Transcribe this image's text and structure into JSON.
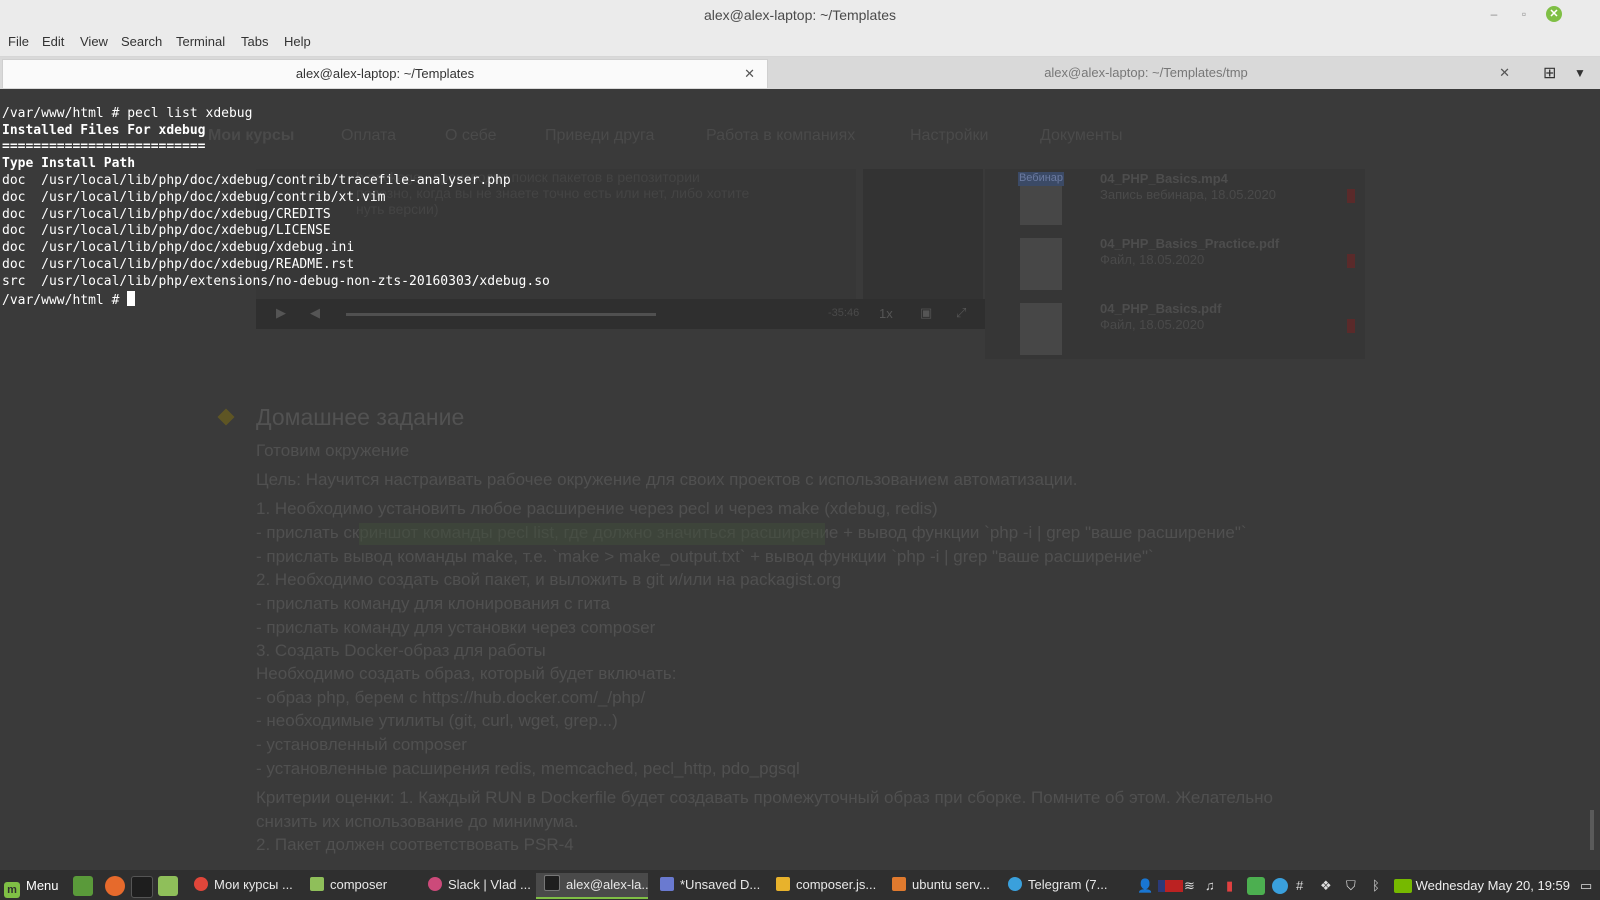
{
  "window": {
    "title": "alex@alex-laptop: ~/Templates",
    "buttons": [
      "–",
      "▫",
      "✕"
    ]
  },
  "menubar": [
    "File",
    "Edit",
    "View",
    "Search",
    "Terminal",
    "Tabs",
    "Help"
  ],
  "tabs": [
    {
      "label": "alex@alex-laptop: ~/Templates",
      "active": true
    },
    {
      "label": "alex@alex-laptop: ~/Templates/tmp",
      "active": false
    }
  ],
  "terminal": {
    "lines": [
      {
        "text": "/var/www/html # pecl list xdebug",
        "bold": false
      },
      {
        "text": "Installed Files For xdebug",
        "bold": true
      },
      {
        "text": "==========================",
        "bold": true
      },
      {
        "text": "Type Install Path",
        "bold": true
      },
      {
        "text": "doc  /usr/local/lib/php/doc/xdebug/contrib/tracefile-analyser.php",
        "bold": false
      },
      {
        "text": "doc  /usr/local/lib/php/doc/xdebug/contrib/xt.vim",
        "bold": false
      },
      {
        "text": "doc  /usr/local/lib/php/doc/xdebug/CREDITS",
        "bold": false
      },
      {
        "text": "doc  /usr/local/lib/php/doc/xdebug/LICENSE",
        "bold": false
      },
      {
        "text": "doc  /usr/local/lib/php/doc/xdebug/xdebug.ini",
        "bold": false
      },
      {
        "text": "doc  /usr/local/lib/php/doc/xdebug/README.rst",
        "bold": false
      },
      {
        "text": "src  /usr/local/lib/php/extensions/no-debug-non-zts-20160303/xdebug.so",
        "bold": false
      }
    ],
    "prompt": "/var/www/html # "
  },
  "background_page": {
    "nav": [
      "Мои курсы",
      "Оплата",
      "О себе",
      "Приведи друга",
      "Работа в компаниях",
      "Настройки",
      "Документы"
    ],
    "video_text": [
      "h package - производит поиск пакетов в репозитории",
      "полезно, когда вы не знаете точно есть или нет, либо хотите",
      "нуть версии)"
    ],
    "video_controls": {
      "speed": "1x",
      "time": "-35:46"
    },
    "files": [
      {
        "name": "04_PHP_Basics.mp4",
        "meta": "Запись вебинара, 18.05.2020",
        "chip": "Вебинар"
      },
      {
        "name": "04_PHP_Basics_Practice.pdf",
        "meta": "Файл, 18.05.2020"
      },
      {
        "name": "04_PHP_Basics.pdf",
        "meta": "Файл, 18.05.2020"
      }
    ],
    "homework": {
      "title": "Домашнее задание",
      "subtitle": "Готовим окружение",
      "goal": "Цель: Научится настраивать рабочее окружение для своих проектов с использованием автоматизации.",
      "lines": [
        "1. Необходимо установить любое расширение через pecl и через make (xdebug, redis)",
        "- прислать скриншот команды pecl list, где должно значиться расширение + вывод функции `php -i | grep \"ваше расширение\"`",
        "- прислать вывод команды make, т.е. `make > make_output.txt` + вывод функции `php -i | grep \"ваше расширение\"`",
        "2. Необходимо создать свой пакет, и выложить в git и/или на packagist.org",
        "- прислать команду для клонирования с гита",
        "- прислать команду для установки через composer",
        "3. Создать Docker-образ для работы",
        "Необходимо создать образ, который будет включать:",
        "- образ php, берем с https://hub.docker.com/_/php/",
        "- необходимые утилиты (git, curl, wget, grep...)",
        "- установленный composer",
        "- установленные расширения redis, memcached, pecl_http, pdo_pgsql"
      ],
      "criteria": [
        "Критерии оценки: 1. Каждый RUN в Dockerfile будет создавать промежуточный образ при сборке. Помните об этом. Желательно",
        "снизить их использование до минимума.",
        "2. Пакет должен соответствовать PSR-4"
      ]
    }
  },
  "taskbar": {
    "menu_label": "Menu",
    "tasks": [
      {
        "label": "Мои курсы ...",
        "color": "#e0463a"
      },
      {
        "label": "composer",
        "color": "#8fbf5a"
      },
      {
        "label": "Slack | Vlad ...",
        "color": "#cc4a7a"
      },
      {
        "label": "alex@alex-la...",
        "color": "#1e1e1e"
      },
      {
        "label": "*Unsaved D...",
        "color": "#6a7ad0"
      },
      {
        "label": "composer.js...",
        "color": "#e8b22c"
      },
      {
        "label": "ubuntu serv...",
        "color": "#e07a2e"
      },
      {
        "label": "Telegram (7...",
        "color": "#3aa0dc"
      }
    ],
    "clock": "Wednesday May 20, 19:59"
  }
}
